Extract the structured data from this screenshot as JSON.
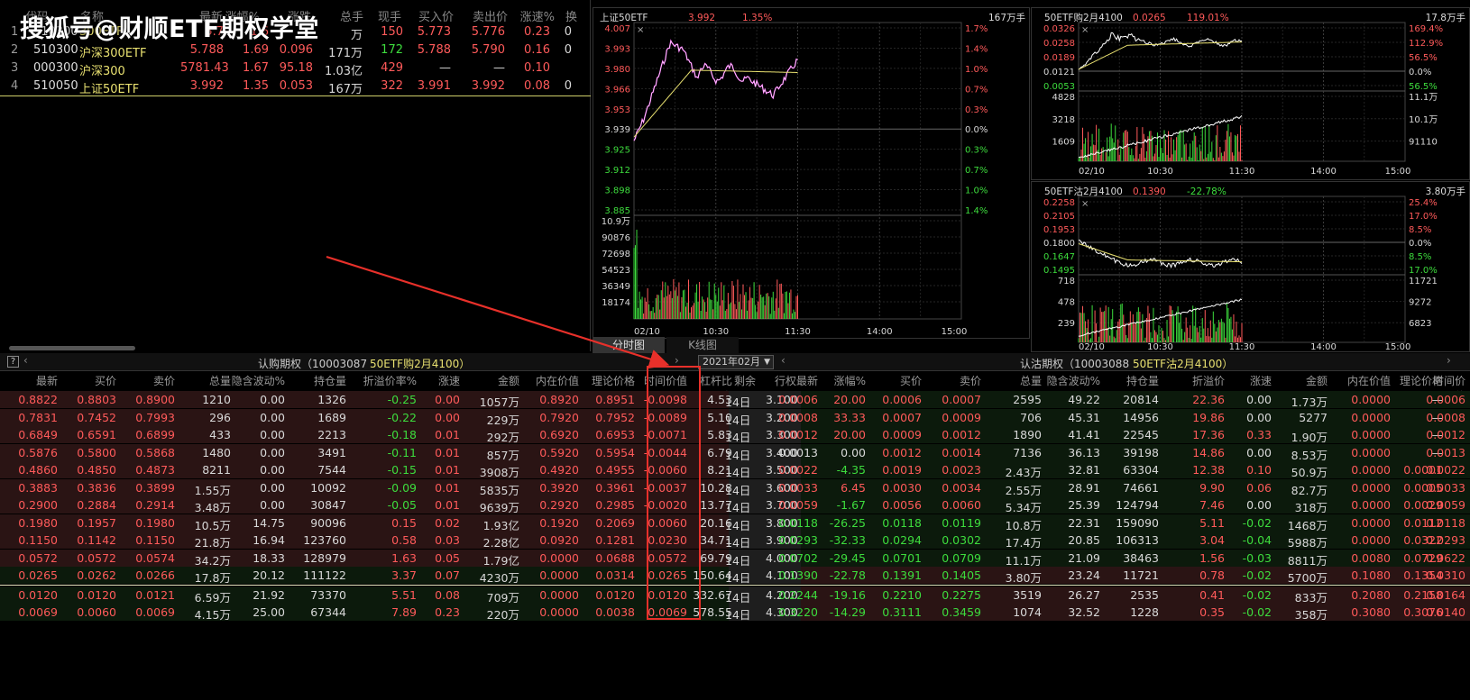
{
  "watermark": "搜狐号@财顺ETF期权学堂",
  "quote": {
    "headers": [
      "代码",
      "名称",
      "最新",
      "涨幅%",
      "涨跌",
      "总手",
      "现手",
      "买入价",
      "卖出价",
      "涨速%",
      "换"
    ],
    "rows": [
      {
        "no": "1",
        "code": "510300",
        "name": "300ETF",
        "last": "5.7",
        "pct": "1.6",
        "chg": "",
        "vol": "万",
        "now": "150",
        "bid": "5.773",
        "ask": "5.776",
        "spd": "0.23",
        "x": "0"
      },
      {
        "no": "2",
        "code": "510300",
        "name": "沪深300ETF",
        "last": "5.788",
        "pct": "1.69",
        "chg": "0.096",
        "vol": "171万",
        "now": "172",
        "bid": "5.788",
        "ask": "5.790",
        "spd": "0.16",
        "x": "0"
      },
      {
        "no": "3",
        "code": "000300",
        "name": "沪深300",
        "last": "5781.43",
        "pct": "1.67",
        "chg": "95.18",
        "vol": "1.03亿",
        "now": "429",
        "bid": "—",
        "ask": "—",
        "spd": "0.10",
        "x": ""
      },
      {
        "no": "4",
        "code": "510050",
        "name": "上证50ETF",
        "last": "3.992",
        "pct": "1.35",
        "chg": "0.053",
        "vol": "167万",
        "now": "322",
        "bid": "3.991",
        "ask": "3.992",
        "spd": "0.08",
        "x": "0"
      }
    ]
  },
  "main_chart": {
    "title": "上证50ETF",
    "price": "3.992",
    "pct": "1.35%",
    "vol": "167万手",
    "left_ticks": [
      "4.007",
      "3.993",
      "3.980",
      "3.966",
      "3.953",
      "3.939",
      "3.925",
      "3.912",
      "3.898",
      "3.885"
    ],
    "right_ticks": [
      "1.7%",
      "1.4%",
      "1.0%",
      "0.7%",
      "0.3%",
      "0.0%",
      "0.3%",
      "0.7%",
      "1.0%",
      "1.4%"
    ],
    "vol_ticks": [
      "10.9万",
      "90876",
      "72698",
      "54523",
      "36349",
      "18174"
    ],
    "x_ticks": [
      "02/10",
      "10:30",
      "11:30",
      "14:00",
      "15:00"
    ],
    "tabs": [
      "分时图",
      "K线图"
    ]
  },
  "call_chart": {
    "title": "50ETF购2月4100",
    "price": "0.0265",
    "pct": "119.01%",
    "vol": "17.8万手",
    "left_ticks": [
      "0.0326",
      "0.0258",
      "0.0189",
      "0.0121",
      "0.0053"
    ],
    "right_ticks": [
      "169.4%",
      "112.9%",
      "56.5%",
      "0.0%",
      "56.5%"
    ],
    "vol_ticks": [
      "4828",
      "3218",
      "1609"
    ],
    "vol_right": [
      "11.1万",
      "10.1万",
      "91110"
    ],
    "x_ticks": [
      "02/10",
      "10:30",
      "11:30",
      "14:00",
      "15:00"
    ]
  },
  "put_chart": {
    "title": "50ETF沽2月4100",
    "price": "0.1390",
    "pct": "-22.78%",
    "vol": "3.80万手",
    "left_ticks": [
      "0.2258",
      "0.2105",
      "0.1953",
      "0.1800",
      "0.1647",
      "0.1495"
    ],
    "right_ticks": [
      "25.4%",
      "17.0%",
      "8.5%",
      "0.0%",
      "8.5%",
      "17.0%"
    ],
    "vol_ticks": [
      "718",
      "478",
      "239"
    ],
    "vol_right": [
      "11721",
      "9272",
      "6823"
    ],
    "x_ticks": [
      "02/10",
      "10:30",
      "11:30",
      "14:00",
      "15:00"
    ]
  },
  "options": {
    "call_label": "认购期权（10003087",
    "call_name": "50ETF购2月4100）",
    "month": "2021年02月",
    "put_label": "认沽期权（10003088",
    "put_name": "50ETF沽2月4100）",
    "call_headers": [
      "最新",
      "买价",
      "卖价",
      "总量",
      "隐含波动%",
      "持仓量",
      "折溢价率%",
      "涨速",
      "金额",
      "内在价值",
      "理论价格",
      "时间价值",
      "杠杆比率"
    ],
    "mid_headers": [
      "剩余",
      "行权"
    ],
    "put_headers": [
      "最新",
      "涨幅%",
      "买价",
      "卖价",
      "总量",
      "隐含波动%",
      "持仓量",
      "折溢价率%",
      "涨速",
      "金额",
      "内在价值",
      "理论价格",
      "时间价值"
    ],
    "rows": [
      {
        "c": [
          "0.8822",
          "0.8803",
          "0.8900",
          "1210",
          "0.00",
          "1326",
          "-0.25",
          "0.00",
          "1057万",
          "0.8920",
          "0.8951",
          "-0.0098",
          "4.53"
        ],
        "d": "14日",
        "k": "3.100",
        "p": [
          "0.0006",
          "20.00",
          "0.0006",
          "0.0007",
          "2595",
          "49.22",
          "20814",
          "22.36",
          "0.00",
          "1.73万",
          "0.0000",
          "—",
          "0.0006"
        ]
      },
      {
        "c": [
          "0.7831",
          "0.7452",
          "0.7993",
          "296",
          "0.00",
          "1689",
          "-0.22",
          "0.00",
          "229万",
          "0.7920",
          "0.7952",
          "-0.0089",
          "5.10"
        ],
        "d": "14日",
        "k": "3.200",
        "p": [
          "0.0008",
          "33.33",
          "0.0007",
          "0.0009",
          "706",
          "45.31",
          "14956",
          "19.86",
          "0.00",
          "5277",
          "0.0000",
          "—",
          "0.0008"
        ]
      },
      {
        "c": [
          "0.6849",
          "0.6591",
          "0.6899",
          "433",
          "0.00",
          "2213",
          "-0.18",
          "0.01",
          "292万",
          "0.6920",
          "0.6953",
          "-0.0071",
          "5.83"
        ],
        "d": "14日",
        "k": "3.300",
        "p": [
          "0.0012",
          "20.00",
          "0.0009",
          "0.0012",
          "1890",
          "41.41",
          "22545",
          "17.36",
          "0.33",
          "1.90万",
          "0.0000",
          "—",
          "0.0012"
        ]
      },
      {
        "c": [
          "0.5876",
          "0.5800",
          "0.5868",
          "1480",
          "0.00",
          "3491",
          "-0.11",
          "0.01",
          "857万",
          "0.5920",
          "0.5954",
          "-0.0044",
          "6.79"
        ],
        "d": "14日",
        "k": "3.400",
        "p": [
          "0.0013",
          "0.00",
          "0.0012",
          "0.0014",
          "7136",
          "36.13",
          "39198",
          "14.86",
          "0.00",
          "8.53万",
          "0.0000",
          "—",
          "0.0013"
        ]
      },
      {
        "c": [
          "0.4860",
          "0.4850",
          "0.4873",
          "8211",
          "0.00",
          "7544",
          "-0.15",
          "0.01",
          "3908万",
          "0.4920",
          "0.4955",
          "-0.0060",
          "8.21"
        ],
        "d": "14日",
        "k": "3.500",
        "p": [
          "0.0022",
          "-4.35",
          "0.0019",
          "0.0023",
          "2.43万",
          "32.81",
          "63304",
          "12.38",
          "0.10",
          "50.9万",
          "0.0000",
          "0.0001",
          "0.0022"
        ]
      },
      {
        "c": [
          "0.3883",
          "0.3836",
          "0.3899",
          "1.55万",
          "0.00",
          "10092",
          "-0.09",
          "0.01",
          "5835万",
          "0.3920",
          "0.3961",
          "-0.0037",
          "10.28"
        ],
        "d": "14日",
        "k": "3.600",
        "p": [
          "0.0033",
          "6.45",
          "0.0030",
          "0.0034",
          "2.55万",
          "28.91",
          "74661",
          "9.90",
          "0.06",
          "82.7万",
          "0.0000",
          "0.0005",
          "0.0033"
        ]
      },
      {
        "c": [
          "0.2900",
          "0.2884",
          "0.2914",
          "3.48万",
          "0.00",
          "30847",
          "-0.05",
          "0.01",
          "9639万",
          "0.2920",
          "0.2985",
          "-0.0020",
          "13.77"
        ],
        "d": "14日",
        "k": "3.700",
        "p": [
          "0.0059",
          "-1.67",
          "0.0056",
          "0.0060",
          "5.34万",
          "25.39",
          "124794",
          "7.46",
          "0.00",
          "318万",
          "0.0000",
          "0.0029",
          "0.0059"
        ]
      },
      {
        "c": [
          "0.1980",
          "0.1957",
          "0.1980",
          "10.5万",
          "14.75",
          "90096",
          "0.15",
          "0.02",
          "1.93亿",
          "0.1920",
          "0.2069",
          "0.0060",
          "20.16"
        ],
        "d": "14日",
        "k": "3.800",
        "p": [
          "0.0118",
          "-26.25",
          "0.0118",
          "0.0119",
          "10.8万",
          "22.31",
          "159090",
          "5.11",
          "-0.02",
          "1468万",
          "0.0000",
          "0.0112",
          "0.0118"
        ]
      },
      {
        "c": [
          "0.1150",
          "0.1142",
          "0.1150",
          "21.8万",
          "16.94",
          "123760",
          "0.58",
          "0.03",
          "2.28亿",
          "0.0920",
          "0.1281",
          "0.0230",
          "34.71"
        ],
        "d": "14日",
        "k": "3.900",
        "p": [
          "0.0293",
          "-32.33",
          "0.0294",
          "0.0302",
          "17.4万",
          "20.85",
          "106313",
          "3.04",
          "-0.04",
          "5988万",
          "0.0000",
          "0.0322",
          "0.0293"
        ]
      },
      {
        "c": [
          "0.0572",
          "0.0572",
          "0.0574",
          "34.2万",
          "18.33",
          "128979",
          "1.63",
          "0.05",
          "1.79亿",
          "0.0000",
          "0.0688",
          "0.0572",
          "69.79"
        ],
        "d": "14日",
        "k": "4.000",
        "p": [
          "0.0702",
          "-29.45",
          "0.0701",
          "0.0709",
          "11.1万",
          "21.09",
          "38463",
          "1.56",
          "-0.03",
          "8811万",
          "0.0080",
          "0.0729",
          "0.0622"
        ]
      },
      {
        "c": [
          "0.0265",
          "0.0262",
          "0.0266",
          "17.8万",
          "20.12",
          "111122",
          "3.37",
          "0.07",
          "4230万",
          "0.0000",
          "0.0314",
          "0.0265",
          "150.64"
        ],
        "d": "14日",
        "k": "4.100",
        "p": [
          "0.1390",
          "-22.78",
          "0.1391",
          "0.1405",
          "3.80万",
          "23.24",
          "11721",
          "0.78",
          "-0.02",
          "5700万",
          "0.1080",
          "0.1354",
          "0.0310"
        ]
      },
      {
        "c": [
          "0.0120",
          "0.0120",
          "0.0121",
          "6.59万",
          "21.92",
          "73370",
          "5.51",
          "0.08",
          "709万",
          "0.0000",
          "0.0120",
          "0.0120",
          "332.67"
        ],
        "d": "14日",
        "k": "4.200",
        "p": [
          "0.2244",
          "-19.16",
          "0.2210",
          "0.2275",
          "3519",
          "26.27",
          "2535",
          "0.41",
          "-0.02",
          "833万",
          "0.2080",
          "0.2158",
          "0.0164"
        ]
      },
      {
        "c": [
          "0.0069",
          "0.0060",
          "0.0069",
          "4.15万",
          "25.00",
          "67344",
          "7.89",
          "0.23",
          "220万",
          "0.0000",
          "0.0038",
          "0.0069",
          "578.55"
        ],
        "d": "14日",
        "k": "4.300",
        "p": [
          "0.3220",
          "-14.29",
          "0.3111",
          "0.3459",
          "1074",
          "32.52",
          "1228",
          "0.35",
          "-0.02",
          "358万",
          "0.3080",
          "0.3076",
          "0.0140"
        ]
      }
    ]
  }
}
